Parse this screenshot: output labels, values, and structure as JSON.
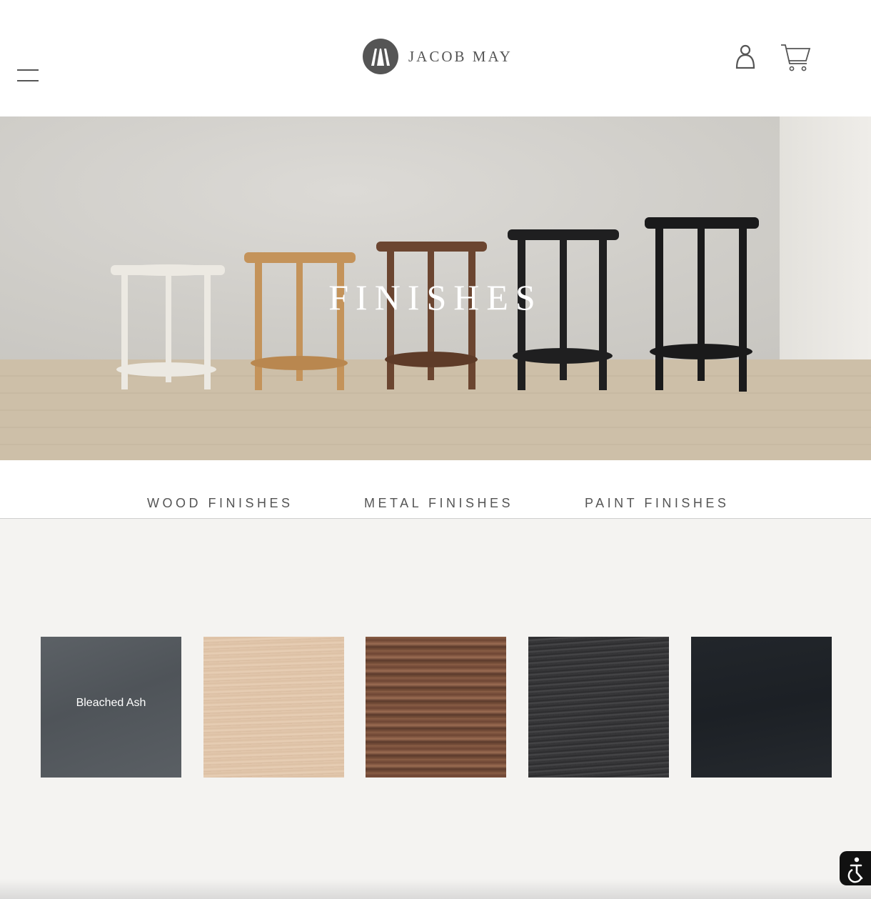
{
  "header": {
    "logo_text": "JACOB MAY",
    "icons": {
      "menu": "hamburger-menu-icon",
      "logo_mark": "jm-monogram-icon",
      "account": "user-icon",
      "cart": "shopping-cart-icon"
    }
  },
  "hero": {
    "title": "FINISHES"
  },
  "tabs": [
    {
      "label": "WOOD FINISHES"
    },
    {
      "label": "METAL FINISHES"
    },
    {
      "label": "PAINT FINISHES"
    }
  ],
  "swatches": [
    {
      "label": "Bleached Ash",
      "color": "#565b60"
    },
    {
      "label": "",
      "color": "#e0c6ab"
    },
    {
      "label": "",
      "color": "#7a503b"
    },
    {
      "label": "",
      "color": "#353537"
    },
    {
      "label": "",
      "color": "#202428"
    }
  ],
  "accessibility": {
    "icon": "accessibility-icon"
  }
}
